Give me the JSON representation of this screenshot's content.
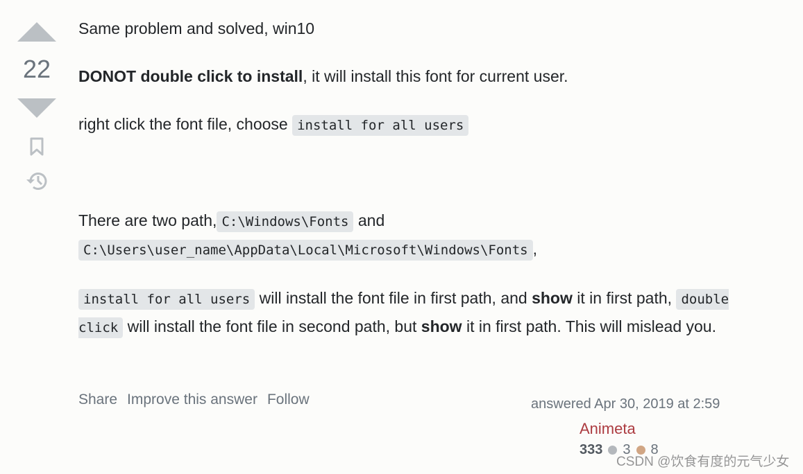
{
  "vote": {
    "count": "22",
    "upvote_icon": "upvote-arrow-icon",
    "downvote_icon": "downvote-arrow-icon",
    "bookmark_icon": "bookmark-icon",
    "history_icon": "history-icon"
  },
  "post": {
    "line1": "Same problem and solved, win10",
    "line2_bold": "DONOT double click to install",
    "line2_rest": ", it will install this font for current user.",
    "line3_text": "right click the font file, choose ",
    "line3_code": "install for all users",
    "line4_text": "There are two path,",
    "line4_code1": "C:\\Windows\\Fonts",
    "line4_and": " and ",
    "line4_code2": "C:\\Users\\user_name\\AppData\\Local\\Microsoft\\Windows\\Fonts",
    "line4_end": ",",
    "line5_code1": "install for all users",
    "line5_text1": " will install the font file in first path, and ",
    "line5_bold1": "show",
    "line5_text2": " it in first path, ",
    "line5_code2": "double click",
    "line5_text3": " will install the font file in second path, but ",
    "line5_bold2": "show",
    "line5_text4": " it in first path. This will mislead you."
  },
  "actions": {
    "share": "Share",
    "improve": "Improve this answer",
    "follow": "Follow"
  },
  "signature": {
    "answered": "answered Apr 30, 2019 at 2:59",
    "user": "Animeta",
    "reputation": "333",
    "silver_count": "3",
    "bronze_count": "8",
    "silver_color": "#b4b8bc",
    "bronze_color": "#d1a684"
  },
  "watermark": "CSDN @饮食有度的元气少女"
}
